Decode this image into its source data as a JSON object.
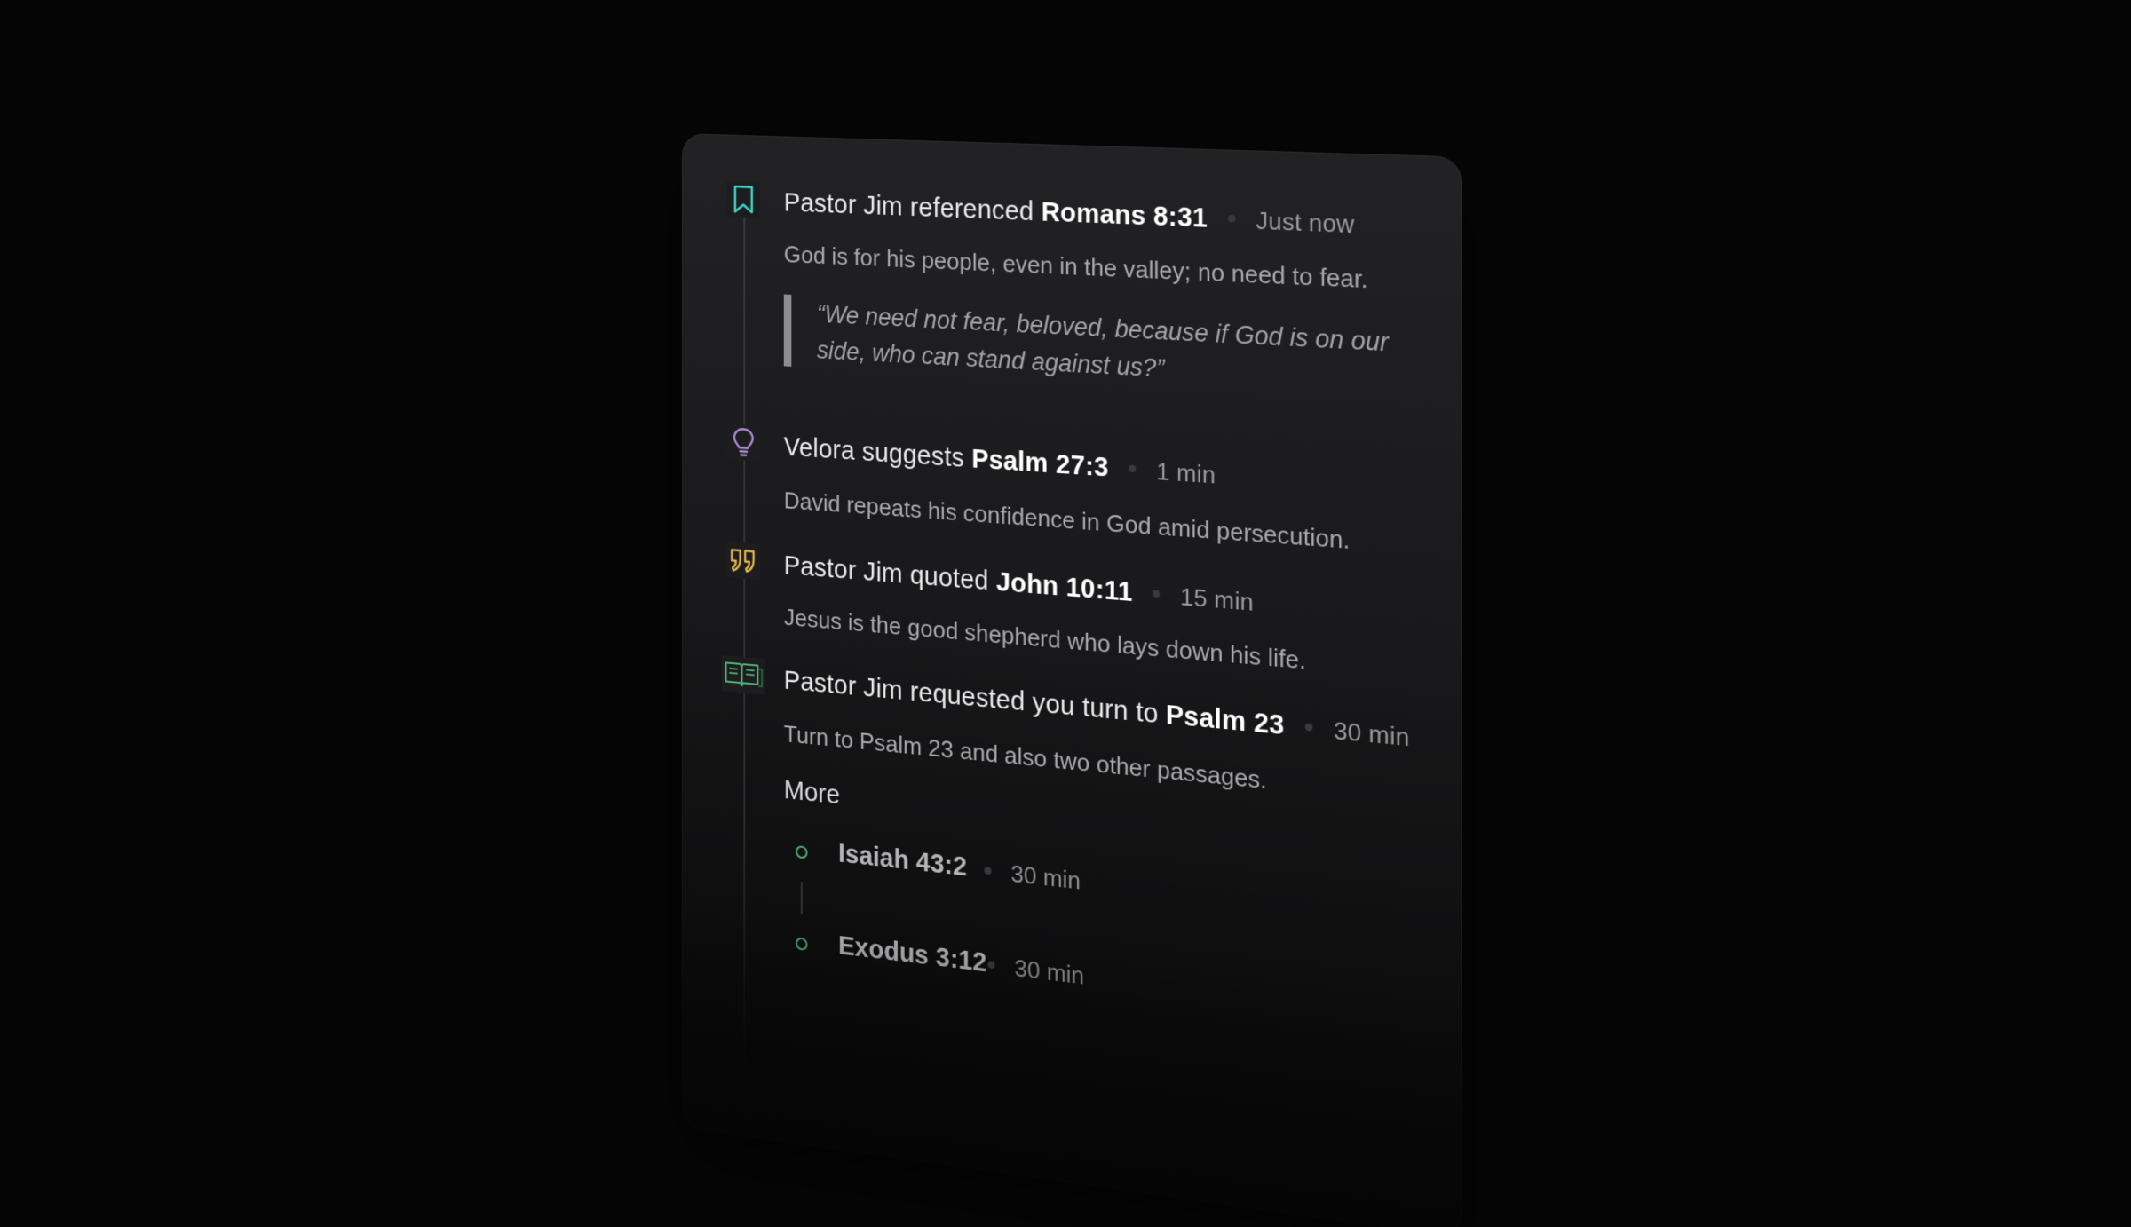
{
  "feed": {
    "entries": [
      {
        "icon": "bookmark-icon",
        "icon_color": "#3fd2c7",
        "actor_text": "Pastor Jim referenced ",
        "reference": "Romans 8:31",
        "time": "Just now",
        "description": "God is for his people, even in the valley; no need to fear.",
        "quote": "“We need not fear, beloved, because if God is on our side, who can stand against us?”"
      },
      {
        "icon": "lightbulb-icon",
        "icon_color": "#a98bd6",
        "actor_text": "Velora suggests ",
        "reference": "Psalm 27:3",
        "time": "1 min",
        "description": "David repeats his confidence in God amid persecution."
      },
      {
        "icon": "quote-icon",
        "icon_color": "#e0b548",
        "actor_text": "Pastor Jim quoted ",
        "reference": "John 10:11",
        "time": "15 min",
        "description": "Jesus is the good shepherd who lays down his life."
      },
      {
        "icon": "open-book-icon",
        "icon_color": "#4caf73",
        "actor_text": "Pastor Jim requested you turn to ",
        "reference": "Psalm 23",
        "time": "30 min",
        "description": "Turn to Psalm 23 and also two other passages.",
        "more_label": "More",
        "more_items": [
          {
            "reference": "Isaiah 43:2",
            "time": "30 min"
          },
          {
            "reference": "Exodus 3:12",
            "time": "30 min"
          }
        ]
      }
    ]
  }
}
